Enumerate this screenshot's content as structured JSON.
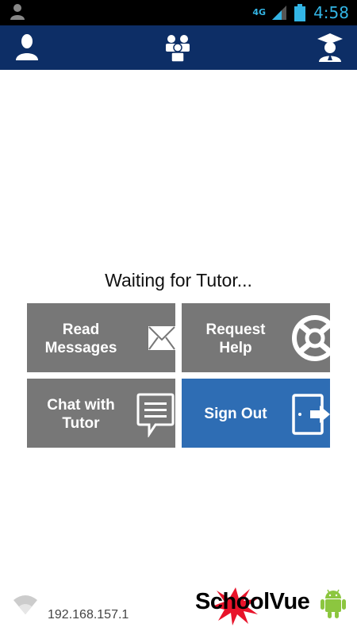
{
  "status_bar": {
    "time": "4:58",
    "network": "4G",
    "icons": [
      "user-icon",
      "network-4g-icon",
      "signal-icon",
      "battery-icon"
    ]
  },
  "nav": {
    "icons": [
      "profile-icon",
      "group-icon",
      "graduate-icon"
    ]
  },
  "main": {
    "title": "Waiting for Tutor...",
    "tiles": [
      {
        "label": "Read\nMessages",
        "icon": "envelope-icon"
      },
      {
        "label": "Request\nHelp",
        "icon": "lifebuoy-icon"
      },
      {
        "label": "Chat with\nTutor",
        "icon": "chat-bubble-icon"
      },
      {
        "label": "Sign Out",
        "icon": "sign-out-door-icon"
      }
    ]
  },
  "footer": {
    "ip": "192.168.157.1",
    "brand": "SchoolVue",
    "icons": [
      "wifi-icon",
      "starburst-logo",
      "android-icon"
    ]
  },
  "colors": {
    "nav": "#0d2e66",
    "tile": "#777777",
    "tile_accent": "#2e6db4",
    "status_accent": "#33b5e5"
  }
}
